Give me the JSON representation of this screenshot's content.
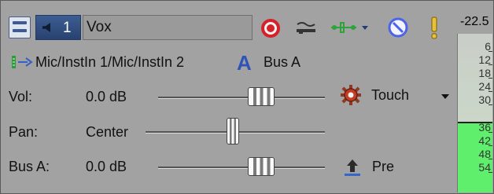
{
  "track": {
    "number": "1",
    "name": "Vox",
    "peak_readout": "-22.5",
    "input_route": "Mic/InstIn 1/Mic/InstIn 2",
    "bus_letter": "A",
    "bus_name": "Bus A"
  },
  "controls": {
    "vol_label": "Vol:",
    "vol_value": "0.0 dB",
    "pan_label": "Pan:",
    "pan_value": "Center",
    "bus_label": "Bus A:",
    "bus_value": "0.0 dB",
    "automation_mode": "Touch",
    "send_mode": "Pre"
  },
  "meter": {
    "ticks": [
      "6",
      "12",
      "18",
      "24",
      "30",
      "36",
      "42",
      "48",
      "54"
    ],
    "upper_color": "#c9cec8",
    "lower_color": "#5fef6d"
  },
  "icons": {
    "expand": "expand-track-icon",
    "speaker": "speaker-icon",
    "record": "record-arm-icon",
    "automation": "automation-settings-icon",
    "fx": "track-fx-icon",
    "mute": "mute-icon",
    "solo": "solo-icon",
    "route": "input-route-icon",
    "bus": "bus-icon",
    "gear": "gear-icon",
    "send": "send-icon"
  },
  "accent_colors": {
    "record": "#d6202a",
    "bus": "#2f54b7",
    "track_header": "#2f4e80",
    "meter_active": "#5fef6d"
  }
}
